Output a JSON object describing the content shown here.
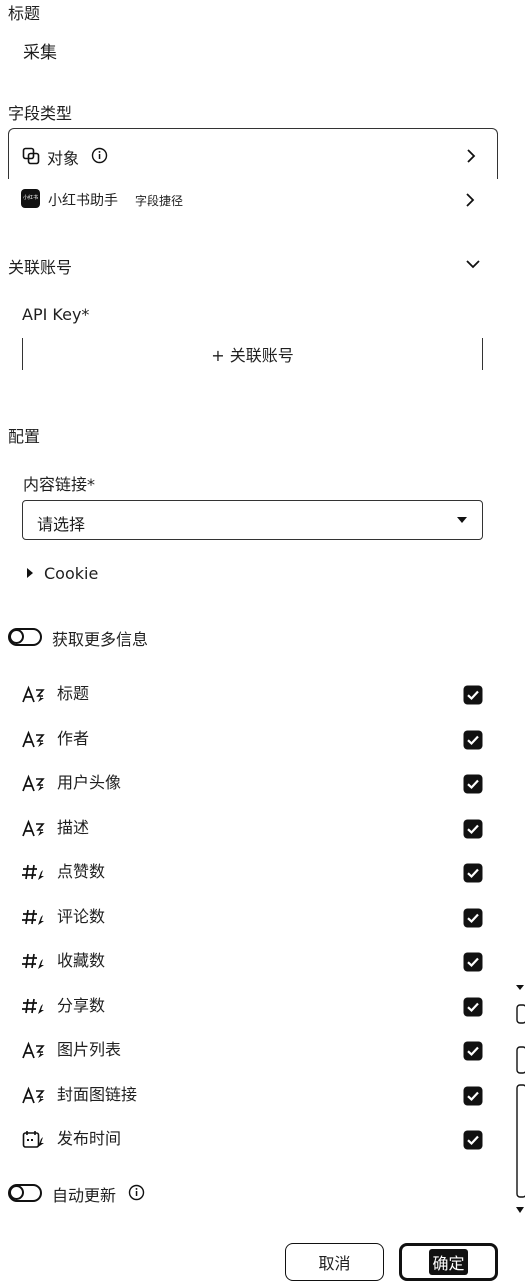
{
  "title_section": {
    "label": "标题",
    "value": "采集"
  },
  "field_type": {
    "label": "字段类型",
    "type_value": "对象",
    "plugin_name": "小红书助手",
    "plugin_logo_text": "小红书",
    "plugin_tag": "字段捷径"
  },
  "linked_account": {
    "label": "关联账号",
    "api_key_label": "API Key",
    "required_mark": "*",
    "add_button_label": "+ 关联账号"
  },
  "config": {
    "label": "配置",
    "content_link_label": "内容链接",
    "required_mark": "*",
    "select_placeholder": "请选择",
    "cookie_label": "Cookie"
  },
  "more_info": {
    "toggle_label": "获取更多信息",
    "fields": [
      {
        "label": "标题",
        "icon": "text-type-icon",
        "checked": true
      },
      {
        "label": "作者",
        "icon": "text-type-icon",
        "checked": true
      },
      {
        "label": "用户头像",
        "icon": "text-type-icon",
        "checked": true
      },
      {
        "label": "描述",
        "icon": "text-type-icon",
        "checked": true
      },
      {
        "label": "点赞数",
        "icon": "number-type-icon",
        "checked": true
      },
      {
        "label": "评论数",
        "icon": "number-type-icon",
        "checked": true
      },
      {
        "label": "收藏数",
        "icon": "number-type-icon",
        "checked": true
      },
      {
        "label": "分享数",
        "icon": "number-type-icon",
        "checked": true
      },
      {
        "label": "图片列表",
        "icon": "text-type-icon",
        "checked": true
      },
      {
        "label": "封面图链接",
        "icon": "text-type-icon",
        "checked": true
      },
      {
        "label": "发布时间",
        "icon": "date-type-icon",
        "checked": true
      }
    ]
  },
  "auto_update": {
    "label": "自动更新"
  },
  "footer": {
    "cancel_label": "取消",
    "confirm_label": "确定"
  }
}
